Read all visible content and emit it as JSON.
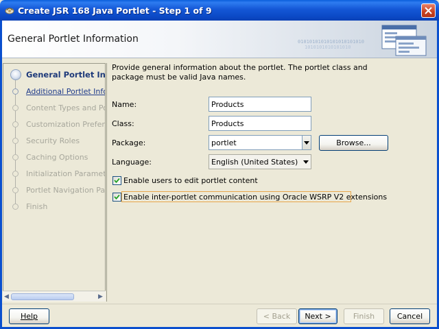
{
  "window": {
    "title": "Create JSR 168 Java Portlet - Step 1 of 9"
  },
  "header": {
    "title": "General Portlet Information"
  },
  "steps": [
    {
      "label": "General Portlet Information",
      "state": "active"
    },
    {
      "label": "Additional Portlet Information",
      "state": "next"
    },
    {
      "label": "Content Types and Portlet Modes",
      "state": "disabled"
    },
    {
      "label": "Customization Preferences",
      "state": "disabled"
    },
    {
      "label": "Security Roles",
      "state": "disabled"
    },
    {
      "label": "Caching Options",
      "state": "disabled"
    },
    {
      "label": "Initialization Parameters",
      "state": "disabled"
    },
    {
      "label": "Portlet Navigation Parameters",
      "state": "disabled"
    },
    {
      "label": "Finish",
      "state": "disabled"
    }
  ],
  "form": {
    "intro": "Provide general information about the portlet. The portlet class and package must be valid Java names.",
    "name_label": "Name:",
    "name_value": "Products",
    "class_label": "Class:",
    "class_value": "Products",
    "package_label": "Package:",
    "package_value": "portlet",
    "browse_label": "Browse...",
    "language_label": "Language:",
    "language_value": "English (United States)",
    "edit_checkbox_label": "Enable users to edit portlet content",
    "edit_checked": true,
    "wsrp_checkbox_label": "Enable inter-portlet communication using Oracle WSRP V2 extensions",
    "wsrp_checked": true
  },
  "buttons": {
    "help": "Help",
    "back": "< Back",
    "next": "Next >",
    "finish": "Finish",
    "cancel": "Cancel"
  }
}
